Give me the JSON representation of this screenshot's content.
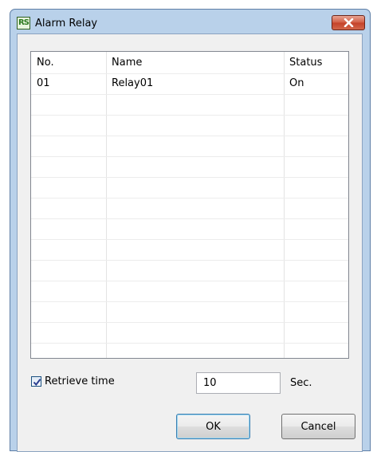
{
  "window": {
    "title": "Alarm Relay",
    "icon": "app-logo-icon",
    "icon_text": "RS"
  },
  "table": {
    "columns": [
      "No.",
      "Name",
      "Status"
    ],
    "rows": [
      {
        "no": "01",
        "name": "Relay01",
        "status": "On"
      }
    ],
    "empty_rows": 13
  },
  "retrieve": {
    "checked": true,
    "label": "Retrieve time",
    "value": "10",
    "unit": "Sec."
  },
  "buttons": {
    "ok": "OK",
    "cancel": "Cancel"
  },
  "colors": {
    "title_bar": "#b9d1ea",
    "close_button": "#c7442b",
    "dialog_bg": "#f0f0f0"
  }
}
